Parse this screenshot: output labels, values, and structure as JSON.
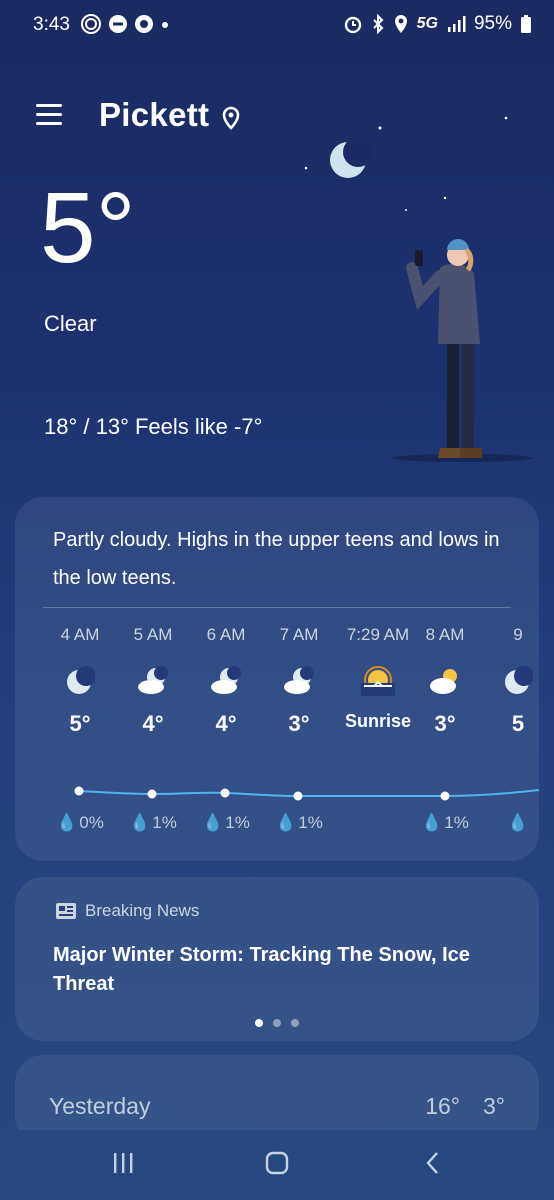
{
  "status": {
    "time": "3:43",
    "network": "5G",
    "battery": "95%"
  },
  "header": {
    "city": "Pickett"
  },
  "current": {
    "temp": "5°",
    "condition": "Clear",
    "hilo": "18° / 13° Feels like -7°"
  },
  "forecast": {
    "summary": "Partly cloudy. Highs in the upper teens and lows in the low teens.",
    "hours": [
      {
        "time": "4 AM",
        "icon": "moon-icon",
        "temp": "5°",
        "precip": "0%"
      },
      {
        "time": "5 AM",
        "icon": "moon-cloud-icon",
        "temp": "4°",
        "precip": "1%"
      },
      {
        "time": "6 AM",
        "icon": "moon-cloud-icon",
        "temp": "4°",
        "precip": "1%"
      },
      {
        "time": "7 AM",
        "icon": "moon-cloud-icon",
        "temp": "3°",
        "precip": "1%"
      },
      {
        "time": "7:29 AM",
        "icon": "sunrise-icon",
        "temp": "Sunrise",
        "precip": ""
      },
      {
        "time": "8 AM",
        "icon": "sun-cloud-icon",
        "temp": "3°",
        "precip": "1%"
      },
      {
        "time": "9",
        "icon": "moon-icon",
        "temp": "5",
        "precip": ""
      }
    ]
  },
  "news": {
    "label": "Breaking News",
    "title": "Major Winter Storm: Tracking The Snow, Ice Threat"
  },
  "yesterday": {
    "label": "Yesterday",
    "hi": "16°",
    "lo": "3°"
  }
}
